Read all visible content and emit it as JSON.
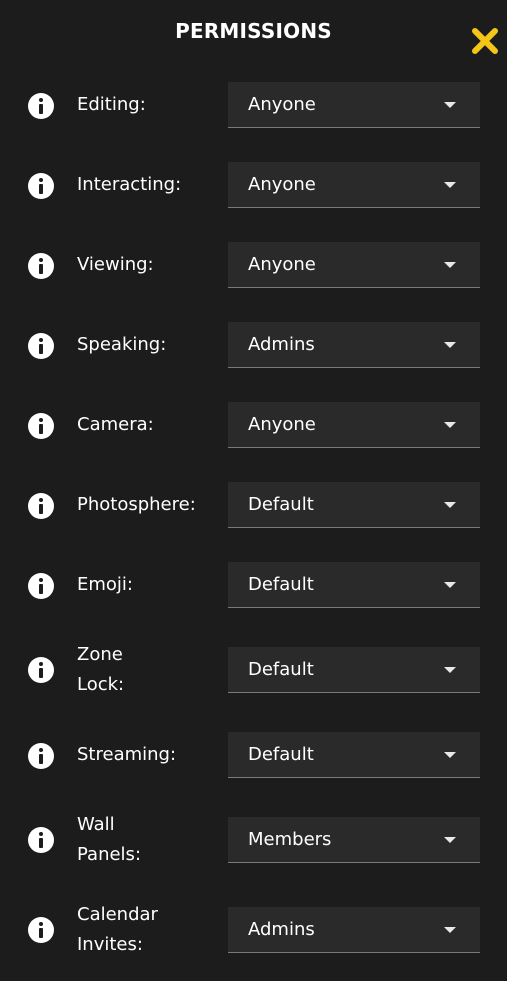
{
  "header": {
    "title": "PERMISSIONS"
  },
  "colors": {
    "background": "#1c1c1c",
    "select_background": "#2a2a2a",
    "close_accent": "#f5c518"
  },
  "permissions": [
    {
      "label": "Editing:",
      "value": "Anyone"
    },
    {
      "label": "Interacting:",
      "value": "Anyone"
    },
    {
      "label": "Viewing:",
      "value": "Anyone"
    },
    {
      "label": "Speaking:",
      "value": "Admins"
    },
    {
      "label": "Camera:",
      "value": "Anyone"
    },
    {
      "label": "Photosphere:",
      "value": "Default"
    },
    {
      "label": "Emoji:",
      "value": "Default"
    },
    {
      "label_lines": [
        "Zone",
        "Lock:"
      ],
      "value": "Default"
    },
    {
      "label": "Streaming:",
      "value": "Default"
    },
    {
      "label_lines": [
        "Wall",
        "Panels:"
      ],
      "value": "Members"
    },
    {
      "label_lines": [
        "Calendar",
        "Invites:"
      ],
      "value": "Admins"
    }
  ]
}
